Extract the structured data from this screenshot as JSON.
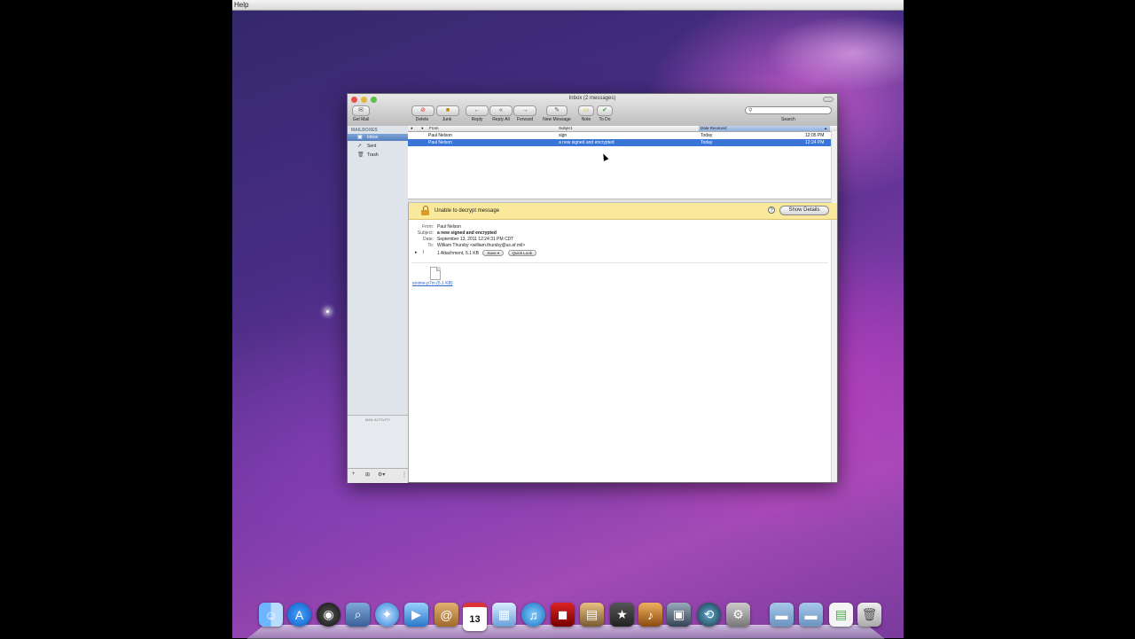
{
  "menubar": {
    "item": "Help"
  },
  "window": {
    "title": "Inbox (2 messages)"
  },
  "toolbar": {
    "get_mail": "Get Mail",
    "delete": "Delete",
    "junk": "Junk",
    "reply": "Reply",
    "reply_all": "Reply All",
    "forward": "Forward",
    "new_message": "New Message",
    "note": "Note",
    "todo": "To Do",
    "search_label": "Search",
    "search_value": ""
  },
  "sidebar": {
    "header": "MAILBOXES",
    "items": [
      {
        "label": "Inbox",
        "icon": "inbox-icon"
      },
      {
        "label": "Sent",
        "icon": "sent-icon"
      },
      {
        "label": "Trash",
        "icon": "trash-icon"
      }
    ],
    "activity_header": "MAIL ACTIVITY",
    "footer": {
      "add": "+",
      "box": "⊞",
      "gear": "⚙▾",
      "handle": "⋮"
    }
  },
  "message_list": {
    "columns": {
      "from": "From",
      "subject": "Subject",
      "date_received": "Date Received"
    },
    "rows": [
      {
        "from": "Paul Nelson",
        "subject": "sign",
        "date": "Today",
        "time": "12:05 PM",
        "selected": false
      },
      {
        "from": "Paul Nelson",
        "subject": "a new signed and encrypted",
        "date": "Today",
        "time": "12:24 PM",
        "selected": true
      }
    ]
  },
  "banner": {
    "text": "Unable to decrypt message",
    "help": "?",
    "button": "Show Details",
    "color": "#fbe99b"
  },
  "message": {
    "labels": {
      "from": "From:",
      "subject": "Subject:",
      "date": "Date:",
      "to": "To:"
    },
    "from": "Paul Nelson",
    "subject": "a new signed and encrypted",
    "date": "September 13, 2011 12:24:31 PM CDT",
    "to": "William Thursby <william.thursby@us.af.mil>",
    "attachment_summary": "1 Attachment, 5.1 KB",
    "save_label": "Save ▾",
    "quick_look_label": "Quick Look",
    "attachment_link": "smime.p7m (5.1 KB)"
  },
  "dock": {
    "items": [
      "finder-icon",
      "app-store-icon",
      "dashboard-icon",
      "preview-icon",
      "safari-icon",
      "facetime-icon",
      "address-book-icon",
      "ical-icon",
      "iphoto-icon",
      "itunes-icon",
      "photo-booth-icon",
      "iphoto-library-icon",
      "imovie-icon",
      "garageband-icon",
      "image-capture-icon",
      "time-machine-icon",
      "system-preferences-icon",
      "applications-folder-icon",
      "documents-folder-icon",
      "document-icon",
      "trash-can-icon"
    ],
    "calendar_day": "13"
  },
  "colors": {
    "selection": "#3875d7",
    "sidebar_bg": "#dee4ea",
    "accent_link": "#3366cc"
  }
}
